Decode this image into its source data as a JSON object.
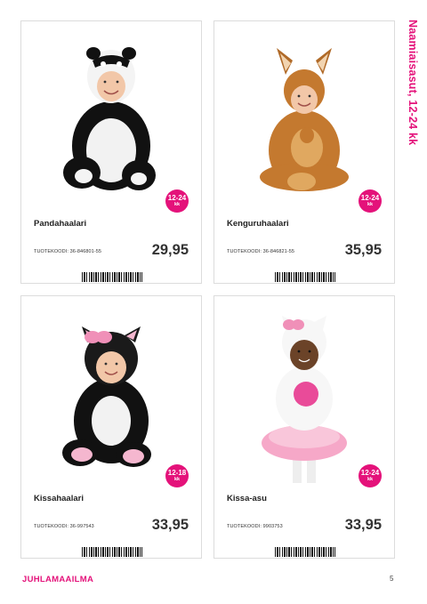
{
  "section_title": "Naamiaisasut, 12-24 kk",
  "code_label": "TUOTEKOODI:",
  "products": [
    {
      "name": "Pandahaalari",
      "code": "36-846801-55",
      "price": "29,95",
      "age": "12-24",
      "age_unit": "kk"
    },
    {
      "name": "Kenguruhaalari",
      "code": "36-846821-55",
      "price": "35,95",
      "age": "12-24",
      "age_unit": "kk"
    },
    {
      "name": "Kissahaalari",
      "code": "36-997543",
      "price": "33,95",
      "age": "12-18",
      "age_unit": "kk"
    },
    {
      "name": "Kissa-asu",
      "code": "9903753",
      "price": "33,95",
      "age": "12-24",
      "age_unit": "kk"
    }
  ],
  "brand": "JUHLAMAAILMA",
  "page_number": "5",
  "colors": {
    "accent": "#e4127a"
  }
}
